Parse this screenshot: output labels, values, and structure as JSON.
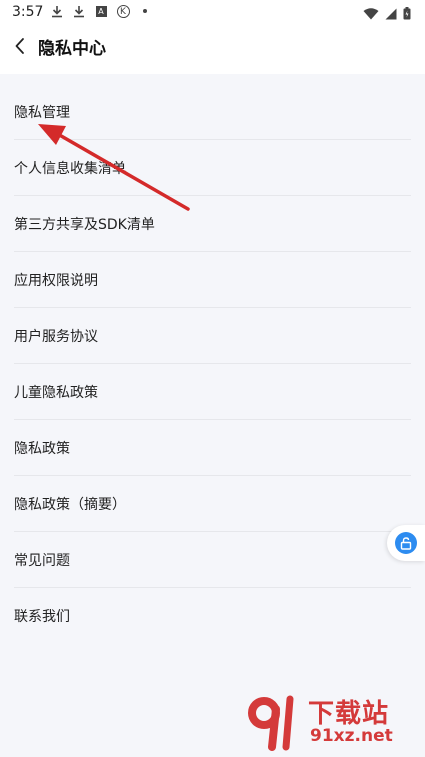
{
  "status_bar": {
    "time": "3:57",
    "k_badge": "K",
    "a_badge": "A"
  },
  "header": {
    "title": "隐私中心"
  },
  "menu": {
    "items": [
      "隐私管理",
      "个人信息收集清单",
      "第三方共享及SDK清单",
      "应用权限说明",
      "用户服务协议",
      "儿童隐私政策",
      "隐私政策",
      "隐私政策（摘要）",
      "常见问题",
      "联系我们"
    ]
  },
  "watermark": {
    "title": "下载站",
    "url": "91xz.net"
  },
  "colors": {
    "accent": "#2d8cf0",
    "arrow": "#d42a2a",
    "watermark": "#d43a3a"
  }
}
